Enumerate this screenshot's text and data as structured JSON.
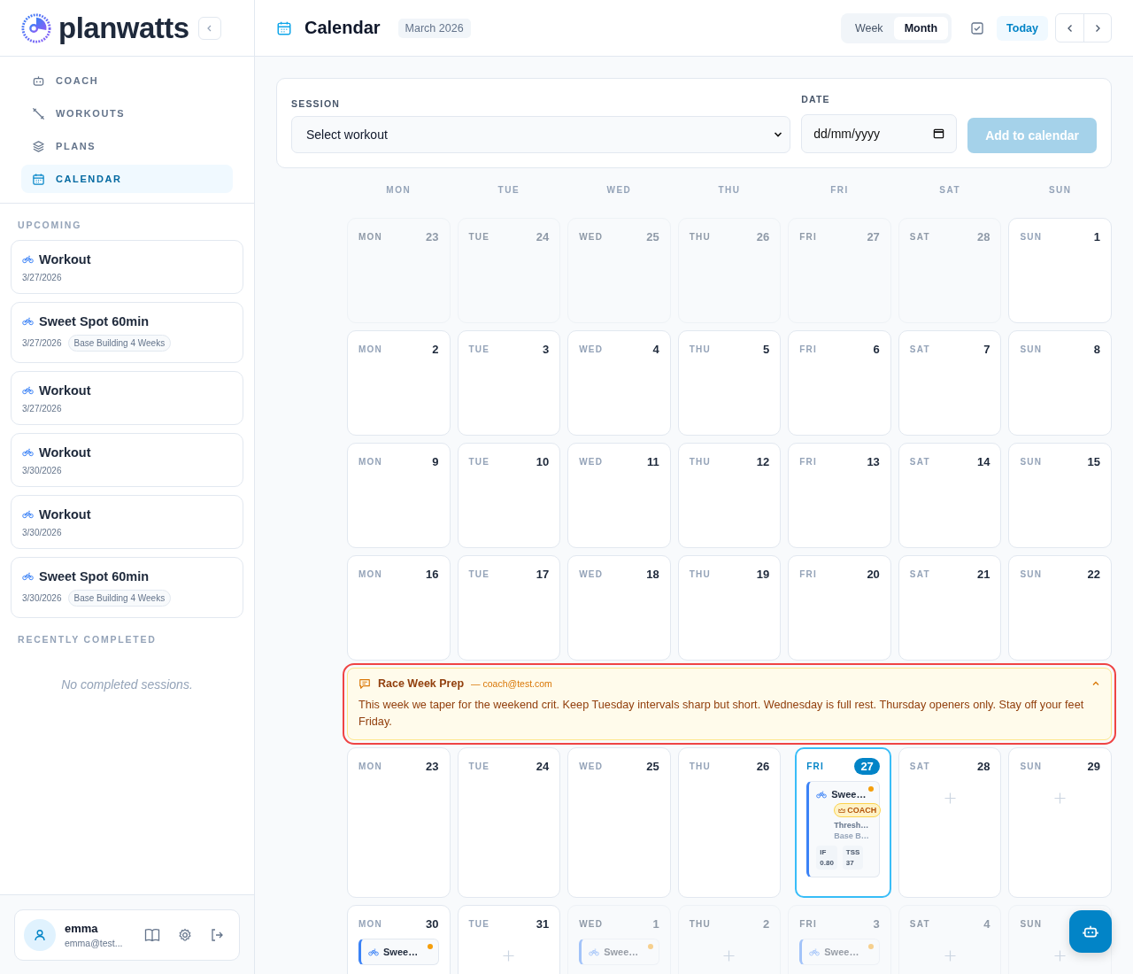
{
  "brand": {
    "name": "planwatts"
  },
  "nav": [
    {
      "label": "COACH",
      "selected": false
    },
    {
      "label": "WORKOUTS",
      "selected": false
    },
    {
      "label": "PLANS",
      "selected": false
    },
    {
      "label": "CALENDAR",
      "selected": true
    }
  ],
  "upcoming": {
    "title": "UPCOMING",
    "items": [
      {
        "title": "Workout",
        "date": "3/27/2026"
      },
      {
        "title": "Sweet Spot 60min",
        "date": "3/27/2026",
        "plan": "Base Building 4 Weeks"
      },
      {
        "title": "Workout",
        "date": "3/27/2026"
      },
      {
        "title": "Workout",
        "date": "3/30/2026"
      },
      {
        "title": "Workout",
        "date": "3/30/2026"
      },
      {
        "title": "Sweet Spot 60min",
        "date": "3/30/2026",
        "plan": "Base Building 4 Weeks"
      }
    ]
  },
  "completed": {
    "title": "RECENTLY COMPLETED",
    "empty": "No completed sessions."
  },
  "user": {
    "name": "emma",
    "email": "emma@test..."
  },
  "header": {
    "title": "Calendar",
    "period": "March 2026",
    "views": [
      {
        "label": "Week",
        "selected": false
      },
      {
        "label": "Month",
        "selected": true
      }
    ],
    "today": "Today"
  },
  "form": {
    "session_label": "SESSION",
    "session_value": "Select workout",
    "date_label": "DATE",
    "date_placeholder": "dd/mm/yyyy",
    "add": "Add to calendar",
    "add_disabled": true
  },
  "weekdays": [
    "MON",
    "TUE",
    "WED",
    "THU",
    "FRI",
    "SAT",
    "SUN"
  ],
  "weeks": [
    {
      "days": [
        {
          "day": "MON",
          "date": "23",
          "outside": true
        },
        {
          "day": "TUE",
          "date": "24",
          "outside": true
        },
        {
          "day": "WED",
          "date": "25",
          "outside": true
        },
        {
          "day": "THU",
          "date": "26",
          "outside": true
        },
        {
          "day": "FRI",
          "date": "27",
          "outside": true
        },
        {
          "day": "SAT",
          "date": "28",
          "outside": true
        },
        {
          "day": "SUN",
          "date": "1",
          "outside": false
        }
      ]
    },
    {
      "days": [
        {
          "day": "MON",
          "date": "2",
          "outside": false
        },
        {
          "day": "TUE",
          "date": "3",
          "outside": false
        },
        {
          "day": "WED",
          "date": "4",
          "outside": false
        },
        {
          "day": "THU",
          "date": "5",
          "outside": false
        },
        {
          "day": "FRI",
          "date": "6",
          "outside": false
        },
        {
          "day": "SAT",
          "date": "7",
          "outside": false
        },
        {
          "day": "SUN",
          "date": "8",
          "outside": false
        }
      ]
    },
    {
      "days": [
        {
          "day": "MON",
          "date": "9",
          "outside": false
        },
        {
          "day": "TUE",
          "date": "10",
          "outside": false
        },
        {
          "day": "WED",
          "date": "11",
          "outside": false
        },
        {
          "day": "THU",
          "date": "12",
          "outside": false
        },
        {
          "day": "FRI",
          "date": "13",
          "outside": false
        },
        {
          "day": "SAT",
          "date": "14",
          "outside": false
        },
        {
          "day": "SUN",
          "date": "15",
          "outside": false
        }
      ]
    },
    {
      "days": [
        {
          "day": "MON",
          "date": "16",
          "outside": false
        },
        {
          "day": "TUE",
          "date": "17",
          "outside": false
        },
        {
          "day": "WED",
          "date": "18",
          "outside": false
        },
        {
          "day": "THU",
          "date": "19",
          "outside": false
        },
        {
          "day": "FRI",
          "date": "20",
          "outside": false
        },
        {
          "day": "SAT",
          "date": "21",
          "outside": false
        },
        {
          "day": "SUN",
          "date": "22",
          "outside": false
        }
      ]
    },
    {
      "note": {
        "title": "Race Week Prep",
        "author": "— coach@test.com",
        "text": "This week we taper for the weekend crit. Keep Tuesday intervals sharp but short. Wednesday is full rest. Thursday openers only. Stay off your feet Friday.",
        "highlighted": true,
        "expanded": true
      },
      "days": [
        {
          "day": "MON",
          "date": "23",
          "outside": false
        },
        {
          "day": "TUE",
          "date": "24",
          "outside": false
        },
        {
          "day": "WED",
          "date": "25",
          "outside": false
        },
        {
          "day": "THU",
          "date": "26",
          "outside": false
        },
        {
          "day": "FRI",
          "date": "27",
          "outside": false,
          "today": true,
          "sessions": [
            {
              "title": "Swee…",
              "dot": true,
              "badge": "COACH",
              "subtitle": "Thresh…",
              "plan": "Base B…",
              "metrics": [
                {
                  "label": "IF",
                  "value": "0.80"
                },
                {
                  "label": "TSS",
                  "value": "37"
                }
              ]
            }
          ]
        },
        {
          "day": "SAT",
          "date": "28",
          "outside": false,
          "can_add": true
        },
        {
          "day": "SUN",
          "date": "29",
          "outside": false,
          "can_add": true
        }
      ]
    },
    {
      "days": [
        {
          "day": "MON",
          "date": "30",
          "outside": false,
          "sessions": [
            {
              "title": "Swee…",
              "dot": true
            }
          ]
        },
        {
          "day": "TUE",
          "date": "31",
          "outside": false,
          "can_add": true
        },
        {
          "day": "WED",
          "date": "1",
          "outside": true,
          "sessions": [
            {
              "title": "Swee…",
              "dot": true
            }
          ]
        },
        {
          "day": "THU",
          "date": "2",
          "outside": true,
          "can_add": true
        },
        {
          "day": "FRI",
          "date": "3",
          "outside": true,
          "sessions": [
            {
              "title": "Swee…",
              "dot": true
            }
          ]
        },
        {
          "day": "SAT",
          "date": "4",
          "outside": true,
          "can_add": true
        },
        {
          "day": "SUN",
          "outside": true,
          "can_add": true
        }
      ]
    }
  ]
}
